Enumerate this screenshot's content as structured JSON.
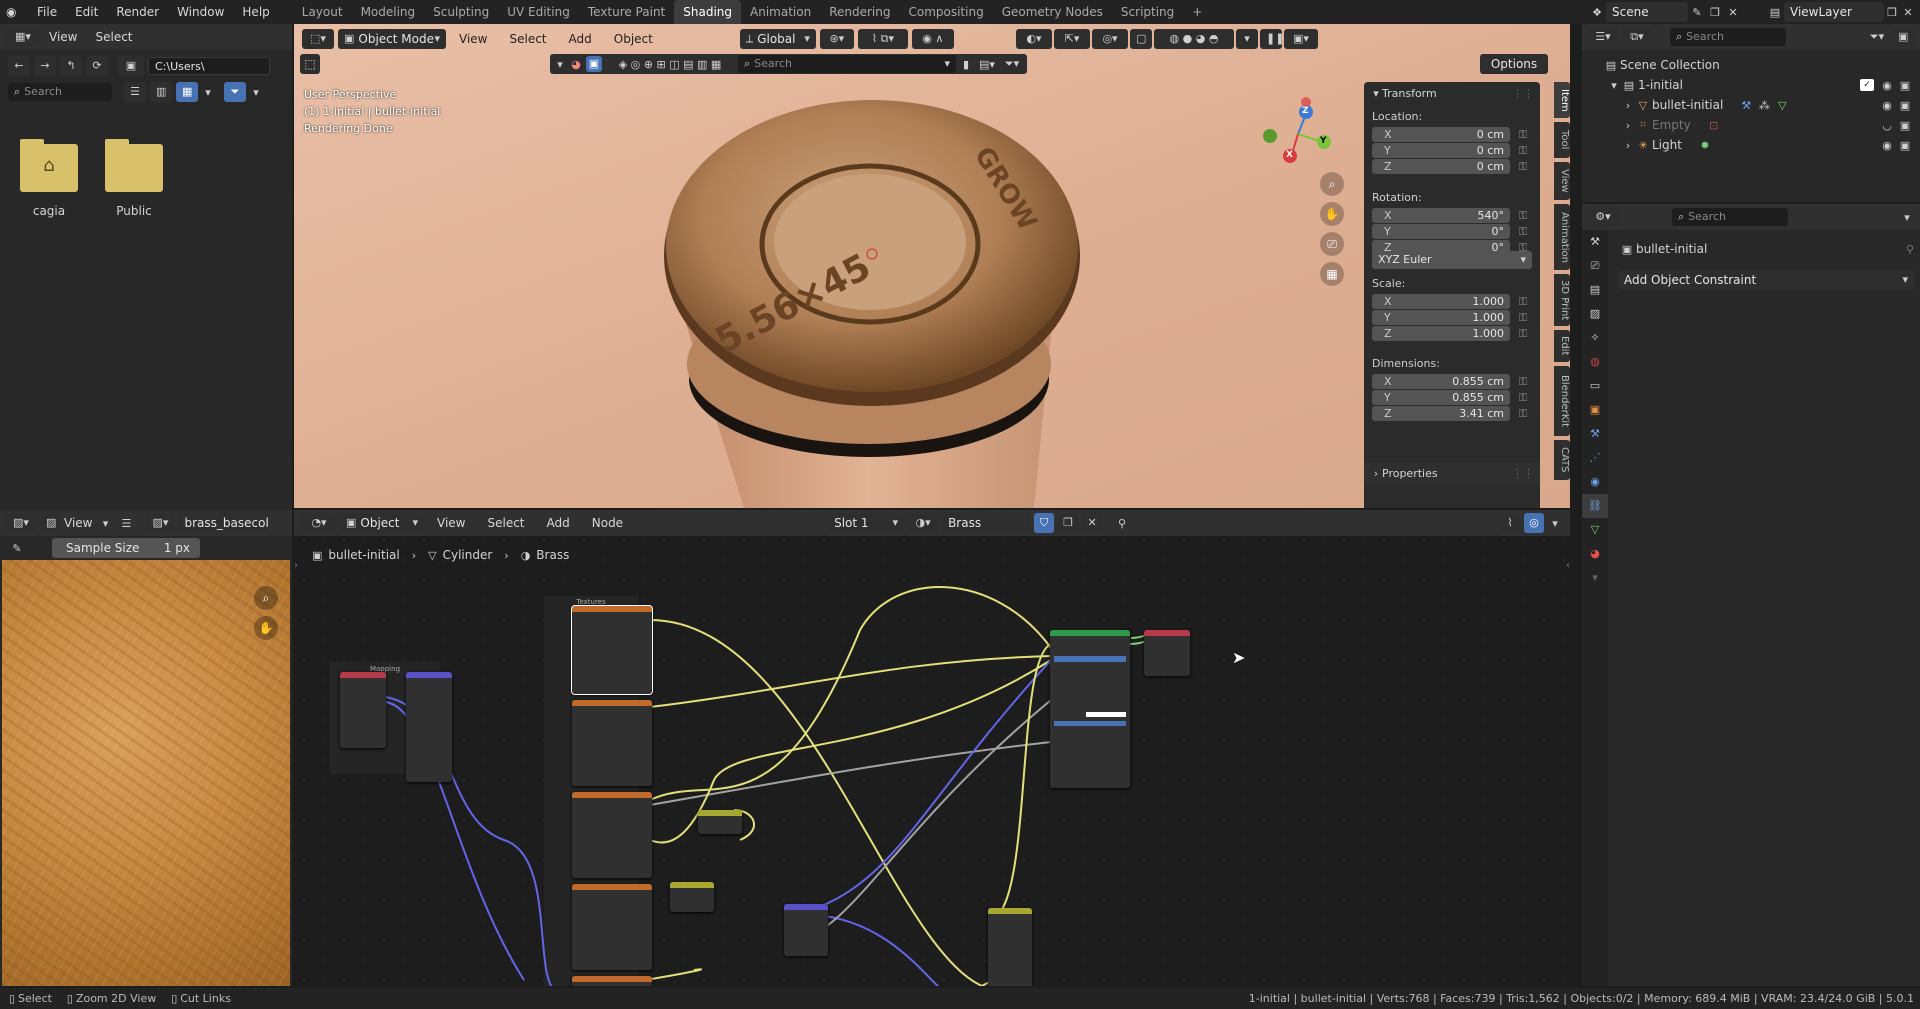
{
  "topbar": {
    "menus": [
      "File",
      "Edit",
      "Render",
      "Window",
      "Help"
    ],
    "workspaces": [
      "Layout",
      "Modeling",
      "Sculpting",
      "UV Editing",
      "Texture Paint",
      "Shading",
      "Animation",
      "Rendering",
      "Compositing",
      "Geometry Nodes",
      "Scripting"
    ],
    "active_workspace": "Shading",
    "add_tab": "+",
    "scene": "Scene",
    "view_layer": "ViewLayer"
  },
  "file_browser": {
    "menus": [
      "View",
      "Select"
    ],
    "path": "C:\\Users\\",
    "search_placeholder": "Search",
    "items": [
      {
        "name": "cagia",
        "icon": "home-folder-icon"
      },
      {
        "name": "Public",
        "icon": "folder-icon"
      }
    ]
  },
  "viewport": {
    "mode": "Object Mode",
    "menus": [
      "View",
      "Select",
      "Add",
      "Object"
    ],
    "orientation": "Global",
    "search_placeholder": "Search",
    "options": "Options",
    "overlay_lines": [
      "User Perspective",
      "(1) 1-initial | bullet-initial",
      "Rendering Done"
    ],
    "axis_labels": {
      "x": "X",
      "y": "Y",
      "z": "Z"
    },
    "side_tabs": [
      "Item",
      "Tool",
      "View",
      "Animation",
      "3D Print",
      "Edit",
      "BlenderKit",
      "CATS"
    ]
  },
  "transform_panel": {
    "title": "Transform",
    "location_label": "Location:",
    "location": [
      {
        "axis": "X",
        "value": "0 cm"
      },
      {
        "axis": "Y",
        "value": "0 cm"
      },
      {
        "axis": "Z",
        "value": "0 cm"
      }
    ],
    "rotation_label": "Rotation:",
    "rotation": [
      {
        "axis": "X",
        "value": "540°"
      },
      {
        "axis": "Y",
        "value": "0°"
      },
      {
        "axis": "Z",
        "value": "0°"
      }
    ],
    "rotation_mode": "XYZ Euler",
    "scale_label": "Scale:",
    "scale": [
      {
        "axis": "X",
        "value": "1.000"
      },
      {
        "axis": "Y",
        "value": "1.000"
      },
      {
        "axis": "Z",
        "value": "1.000"
      }
    ],
    "dimensions_label": "Dimensions:",
    "dimensions": [
      {
        "axis": "X",
        "value": "0.855 cm"
      },
      {
        "axis": "Y",
        "value": "0.855 cm"
      },
      {
        "axis": "Z",
        "value": "3.41 cm"
      }
    ],
    "properties": "Properties"
  },
  "image_editor": {
    "menu": "View",
    "image_name": "brass_basecolor.j",
    "sample_label": "Sample Size",
    "sample_value": "1 px"
  },
  "node_editor": {
    "mode": "Object",
    "menus": [
      "View",
      "Select",
      "Add",
      "Node"
    ],
    "slot": "Slot 1",
    "material": "Brass",
    "breadcrumb": [
      "bullet-initial",
      "Cylinder",
      "Brass"
    ],
    "frames": {
      "textures": "Textures",
      "mapping": "Mapping"
    }
  },
  "outliner": {
    "search_placeholder": "Search",
    "root": "Scene Collection",
    "collection": "1-initial",
    "objects": [
      "bullet-initial",
      "Empty",
      "Light"
    ]
  },
  "properties_editor": {
    "search_placeholder": "Search",
    "object_name": "bullet-initial",
    "add_constraint": "Add Object Constraint"
  },
  "statusbar": {
    "left": [
      "Select",
      "Zoom 2D View",
      "Cut Links"
    ],
    "right": "1-initial | bullet-initial | Verts:768 | Faces:739 | Tris:1,562 | Objects:0/2 | Memory: 689.4 MiB | VRAM: 23.4/24.0 GiB | 5.0.1"
  },
  "colors": {
    "accent": "#4772b3",
    "header": "#303030",
    "panel": "#282828",
    "active_tab": "#3d3d3d",
    "wire_yellow": "#e3e07a",
    "wire_blue": "#6464e8",
    "wire_gray": "#a3a3a3"
  }
}
